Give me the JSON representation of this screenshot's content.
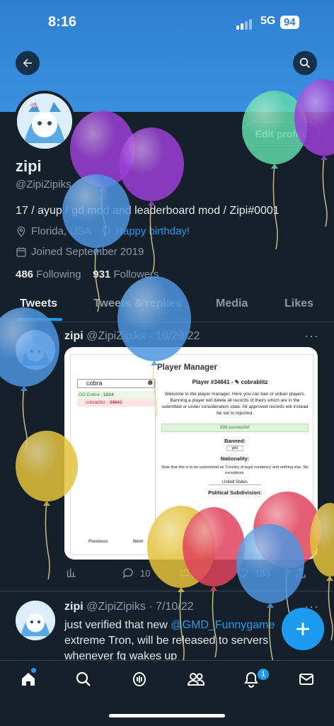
{
  "status": {
    "time": "8:16",
    "network": "5G",
    "battery": "94"
  },
  "profile": {
    "edit_label": "Edit profile",
    "name": "zipi",
    "handle": "@ZipiZipiks",
    "bio": "17 / ayup / gd mod and leaderboard mod / Zipi#0001",
    "location": "Florida, USA",
    "birthday": "Happy birthday!",
    "joined": "Joined September 2019",
    "following_count": "486",
    "following_label": "Following",
    "followers_count": "931",
    "followers_label": "Followers"
  },
  "tabs": [
    {
      "label": "Tweets"
    },
    {
      "label": "Tweets & replies"
    },
    {
      "label": "Media"
    },
    {
      "label": "Likes"
    }
  ],
  "tweets": [
    {
      "name": "zipi",
      "handle_date": "@ZipiZipiks · 10/29/22",
      "more": "···",
      "media": {
        "title": "Player Manager",
        "search_value": "cobra",
        "list": [
          {
            "name": "GD Cobra",
            "score": "1214"
          },
          {
            "name": "cobrablitz",
            "score": "34641"
          }
        ],
        "player_heading": "Player #34641 - ✎ cobrablitz",
        "desc": "Welcome to the player manager. Here you can ban or unban players. Banning a player will delete all records of theirs which are in the submitted or under consideration state. All approved records will instead be set to rejected.",
        "success": "Edit successful!",
        "banned_label": "Banned:",
        "banned_value": "yes",
        "nationality_label": "Nationality:",
        "nationality_note": "Note that this is to be understood as 'Country of legal residency' and nothing else. No exceptions.",
        "country_value": "United States",
        "subdivision_label": "Political Subdivision:",
        "prev": "Previous",
        "next": "Next"
      },
      "replies": "10",
      "retweets": "6",
      "likes": "183"
    },
    {
      "name": "zipi",
      "handle_date": "@ZipiZipiks · 7/10/22",
      "more": "···",
      "text_before": "just verified that new ",
      "mention": "@GMD_Funnygame",
      "text_after": " extreme Tron, will be released to servers whenever fg wakes up"
    }
  ],
  "notifications_badge": "1",
  "colors": {
    "accent": "#1d9bf0",
    "background": "#15202b",
    "banner": "#2f7fd2"
  },
  "icons": [
    "back-arrow-icon",
    "search-icon",
    "location-icon",
    "balloon-icon",
    "calendar-icon",
    "stats-icon",
    "reply-icon",
    "retweet-icon",
    "like-icon",
    "share-icon",
    "compose-plus-icon",
    "home-icon",
    "explore-icon",
    "spaces-icon",
    "communities-icon",
    "bell-icon",
    "mail-icon"
  ]
}
